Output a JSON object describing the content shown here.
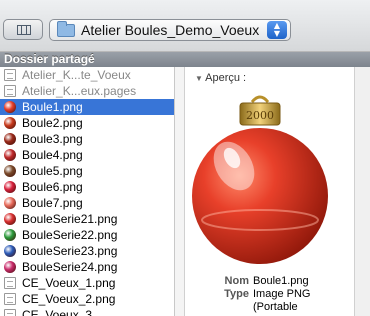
{
  "toolbar": {
    "path_label": "Atelier Boules_Demo_Voeux",
    "stepper_up": "▲",
    "stepper_down": "▼"
  },
  "sidebar": {
    "shared_label": "Dossier partagé"
  },
  "files": [
    {
      "name": "Atelier_K...te_Voeux",
      "kind": "doc",
      "dim": true
    },
    {
      "name": "Atelier_K...eux.pages",
      "kind": "doc",
      "dim": true
    },
    {
      "name": "Boule1.png",
      "kind": "ball",
      "color": "#e8402a",
      "selected": true
    },
    {
      "name": "Boule2.png",
      "kind": "ball",
      "color": "#c83a1c"
    },
    {
      "name": "Boule3.png",
      "kind": "ball",
      "color": "#9a2a1a"
    },
    {
      "name": "Boule4.png",
      "kind": "ball",
      "color": "#c0282a"
    },
    {
      "name": "Boule5.png",
      "kind": "ball",
      "color": "#7a4a2a"
    },
    {
      "name": "Boule6.png",
      "kind": "ball",
      "color": "#d8203c"
    },
    {
      "name": "Boule7.png",
      "kind": "ball",
      "color": "#e86a5a"
    },
    {
      "name": "BouleSerie21.png",
      "kind": "ball",
      "color": "#d83030"
    },
    {
      "name": "BouleSerie22.png",
      "kind": "ball",
      "color": "#2a9a3a"
    },
    {
      "name": "BouleSerie23.png",
      "kind": "ball",
      "color": "#2a5ab8"
    },
    {
      "name": "BouleSerie24.png",
      "kind": "ball",
      "color": "#c82a6a"
    },
    {
      "name": "CE_Voeux_1.png",
      "kind": "doc"
    },
    {
      "name": "CE_Voeux_2.png",
      "kind": "doc"
    },
    {
      "name": "CE_Voeux_3",
      "kind": "doc"
    }
  ],
  "preview": {
    "heading": "Aperçu :",
    "ornament_text": "2000",
    "colors": {
      "ball": "#e23320",
      "cap": "#c9a23c",
      "selection": "#3875d7"
    },
    "meta": [
      {
        "key": "Nom",
        "value": "Boule1.png"
      },
      {
        "key": "Type",
        "value": "Image PNG"
      },
      {
        "key": "",
        "value": "(Portable"
      }
    ]
  }
}
